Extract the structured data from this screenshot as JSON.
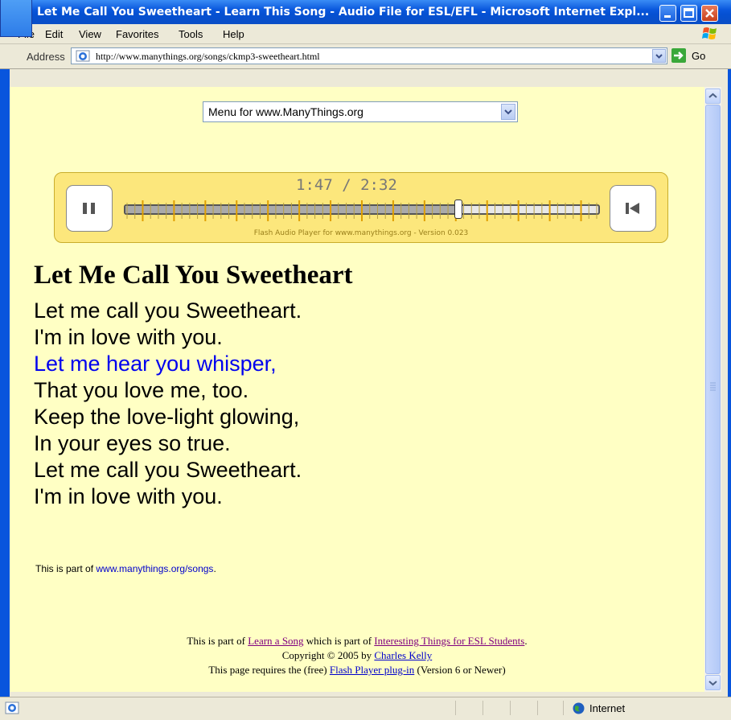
{
  "window": {
    "title": "Let Me Call You Sweetheart - Learn This Song - Audio File for ESL/EFL - Microsoft Internet Expl..."
  },
  "menu": [
    "File",
    "Edit",
    "View",
    "Favorites",
    "Tools",
    "Help"
  ],
  "address": {
    "label": "Address",
    "url": "http://www.manythings.org/songs/ckmp3-sweetheart.html",
    "go_label": "Go"
  },
  "site_menu": {
    "selected": "Menu for www.ManyThings.org"
  },
  "player": {
    "time": "1:47 / 2:32",
    "progress": 0.704,
    "caption": "Flash Audio Player for www.manythings.org  -  Version 0.023"
  },
  "song": {
    "title": "Let Me Call You Sweetheart",
    "lyrics": [
      "Let me call you Sweetheart.",
      "I'm in love with you.",
      "Let me hear you whisper,",
      "That you love me, too.",
      "Keep the love-light glowing,",
      "In your eyes so true.",
      "Let me call you Sweetheart.",
      "I'm in love with you."
    ],
    "highlighted_index": 2
  },
  "part_of": {
    "prefix": "This is part of ",
    "link": "www.manythings.org/songs",
    "suffix": "."
  },
  "footer": {
    "l1_prefix": "This is part of ",
    "l1_link1": "Learn a Song",
    "l1_mid": " which is part of ",
    "l1_link2": "Interesting Things for ESL Students",
    "l1_suffix": ".",
    "l2_prefix": "Copyright © 2005 by ",
    "l2_link": "Charles Kelly",
    "l3_prefix": "This page requires the (free) ",
    "l3_link": "Flash Player plug-in",
    "l3_suffix": " (Version 6 or Newer)"
  },
  "status": {
    "zone": "Internet"
  },
  "colors": {
    "page_bg": "#ffffc4",
    "player_bg": "#fce77c",
    "highlight": "#0000ee",
    "title_bar": "#0855dd"
  }
}
